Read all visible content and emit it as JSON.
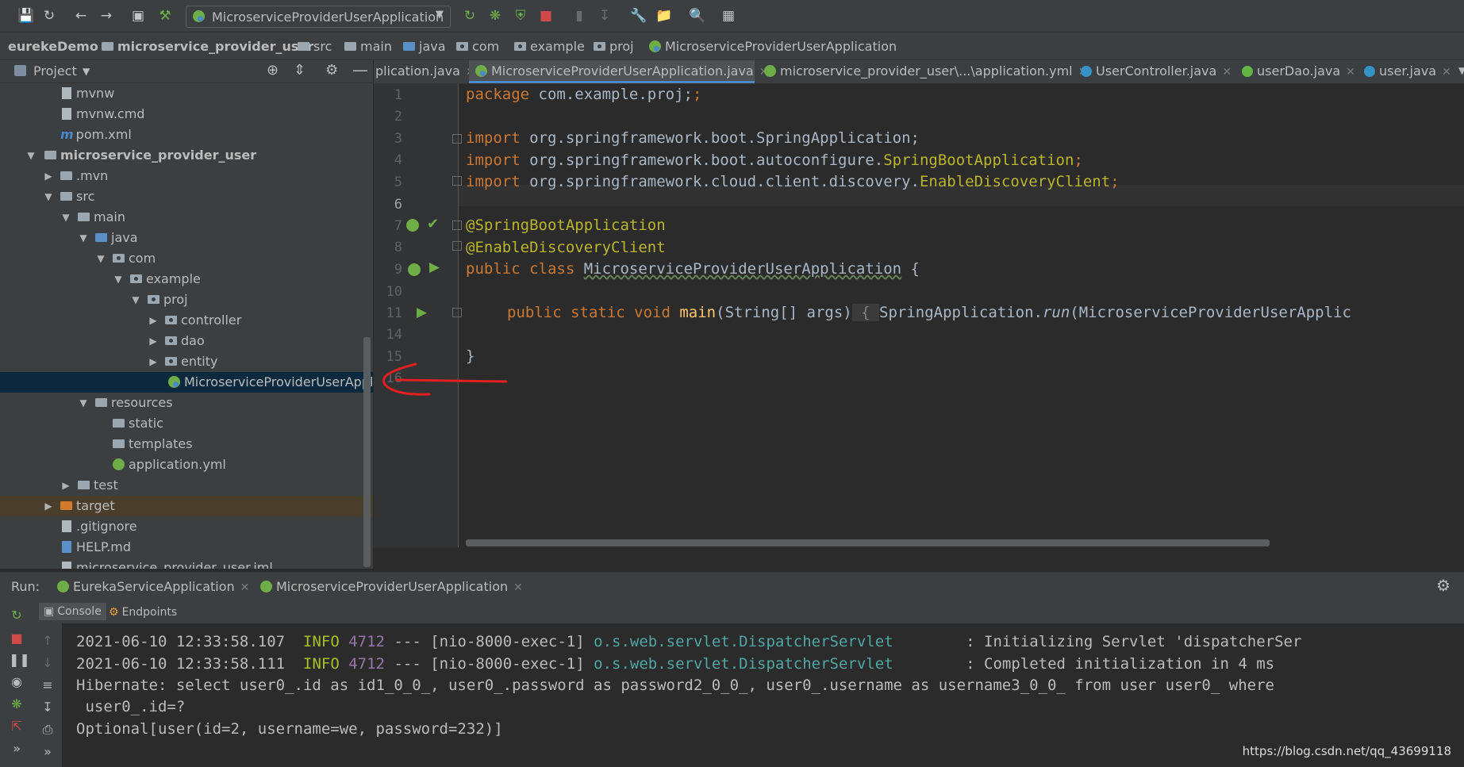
{
  "toolbar": {
    "run_config": "MicroserviceProviderUserApplication",
    "icons": [
      "save-icon",
      "sync-icon",
      "back-icon",
      "forward-icon",
      "structure-icon",
      "build-icon",
      "run-icon",
      "debug-icon",
      "coverage-icon",
      "stop-icon",
      "bookmark-icon",
      "download-icon",
      "wrench-icon",
      "project-structure-icon",
      "search-icon",
      "translate-icon"
    ]
  },
  "breadcrumb": {
    "items": [
      "eurekeDemo",
      "microservice_provider_user",
      "src",
      "main",
      "java",
      "com",
      "example",
      "proj",
      "MicroserviceProviderUserApplication"
    ]
  },
  "project_panel": {
    "title": "Project",
    "items": [
      {
        "label": "mvnw"
      },
      {
        "label": "mvnw.cmd"
      },
      {
        "label": "pom.xml",
        "icon": "m"
      },
      {
        "label": "microservice_provider_user"
      },
      {
        "label": ".mvn"
      },
      {
        "label": "src"
      },
      {
        "label": "main"
      },
      {
        "label": "java"
      },
      {
        "label": "com"
      },
      {
        "label": "example"
      },
      {
        "label": "proj"
      },
      {
        "label": "controller"
      },
      {
        "label": "dao"
      },
      {
        "label": "entity"
      },
      {
        "label": "MicroserviceProviderUserApplic"
      },
      {
        "label": "resources"
      },
      {
        "label": "static"
      },
      {
        "label": "templates"
      },
      {
        "label": "application.yml"
      },
      {
        "label": "test"
      },
      {
        "label": "target"
      },
      {
        "label": ".gitignore"
      },
      {
        "label": "HELP.md"
      },
      {
        "label": "microservice_provider_user.iml"
      }
    ]
  },
  "editor": {
    "tabs": [
      {
        "label": "plication.java"
      },
      {
        "label": "MicroserviceProviderUserApplication.java"
      },
      {
        "label": "microservice_provider_user\\...\\application.yml"
      },
      {
        "label": "UserController.java"
      },
      {
        "label": "userDao.java"
      },
      {
        "label": "user.java"
      }
    ],
    "line_numbers": [
      "1",
      "2",
      "3",
      "4",
      "5",
      "6",
      "7",
      "8",
      "9",
      "10",
      "11",
      "14",
      "15",
      "16"
    ],
    "code": {
      "l1_kw": "package",
      "l1_rest": " com.example.proj;",
      "import_kw": "import",
      "l3_rest": " org.springframework.boot.SpringApplication;",
      "l4_pre": " org.springframework.boot.autoconfigure.",
      "l4_cls": "SpringBootApplication",
      "l4_end": ";",
      "l5_pre": " org.springframework.cloud.client.discovery.",
      "l5_cls": "EnableDiscoveryClient",
      "l5_end": ";",
      "l7": "@SpringBootApplication",
      "l8": "@EnableDiscoveryClient",
      "l9_kw": "public class",
      "l9_cls": "MicroserviceProviderUserApplication",
      "l9_end": " {",
      "l11_kw": "public static void",
      "l11_mth": "main",
      "l11_args": "(String[] args)",
      "l11_brace": " { ",
      "l11_call": "SpringApplication.",
      "l11_run": "run",
      "l11_rest": "(MicroserviceProviderUserApplic",
      "l15": "}"
    }
  },
  "run_panel": {
    "label": "Run:",
    "tabs": [
      {
        "label": "EurekaServiceApplication"
      },
      {
        "label": "MicroserviceProviderUserApplication"
      }
    ],
    "console_tabs": [
      {
        "label": "Console"
      },
      {
        "label": "Endpoints"
      }
    ],
    "log": [
      {
        "time": "2021-06-10 12:33:58.107",
        "level": "INFO",
        "pid": "4712",
        "sep": "---",
        "thread": "[nio-8000-exec-1]",
        "logger": "o.s.web.servlet.DispatcherServlet",
        "msg": ": Initializing Servlet 'dispatcherSer"
      },
      {
        "time": "2021-06-10 12:33:58.111",
        "level": "INFO",
        "pid": "4712",
        "sep": "---",
        "thread": "[nio-8000-exec-1]",
        "logger": "o.s.web.servlet.DispatcherServlet",
        "msg": ": Completed initialization in 4 ms"
      }
    ],
    "hibernate_1": "Hibernate: select user0_.id as id1_0_0_, user0_.password as password2_0_0_, user0_.username as username3_0_0_ from user user0_ where",
    "hibernate_2": " user0_.id=?",
    "optional": "Optional[user(id=2, username=we, password=232)]"
  },
  "watermark": "https://blog.csdn.net/qq_43699118",
  "colors": {
    "keyword": "#cc7832",
    "annotation": "#bbb529",
    "method": "#ffc66d",
    "link": "#4ea7a5",
    "selection": "#0d293e",
    "annotation_stroke": "#e02020"
  }
}
